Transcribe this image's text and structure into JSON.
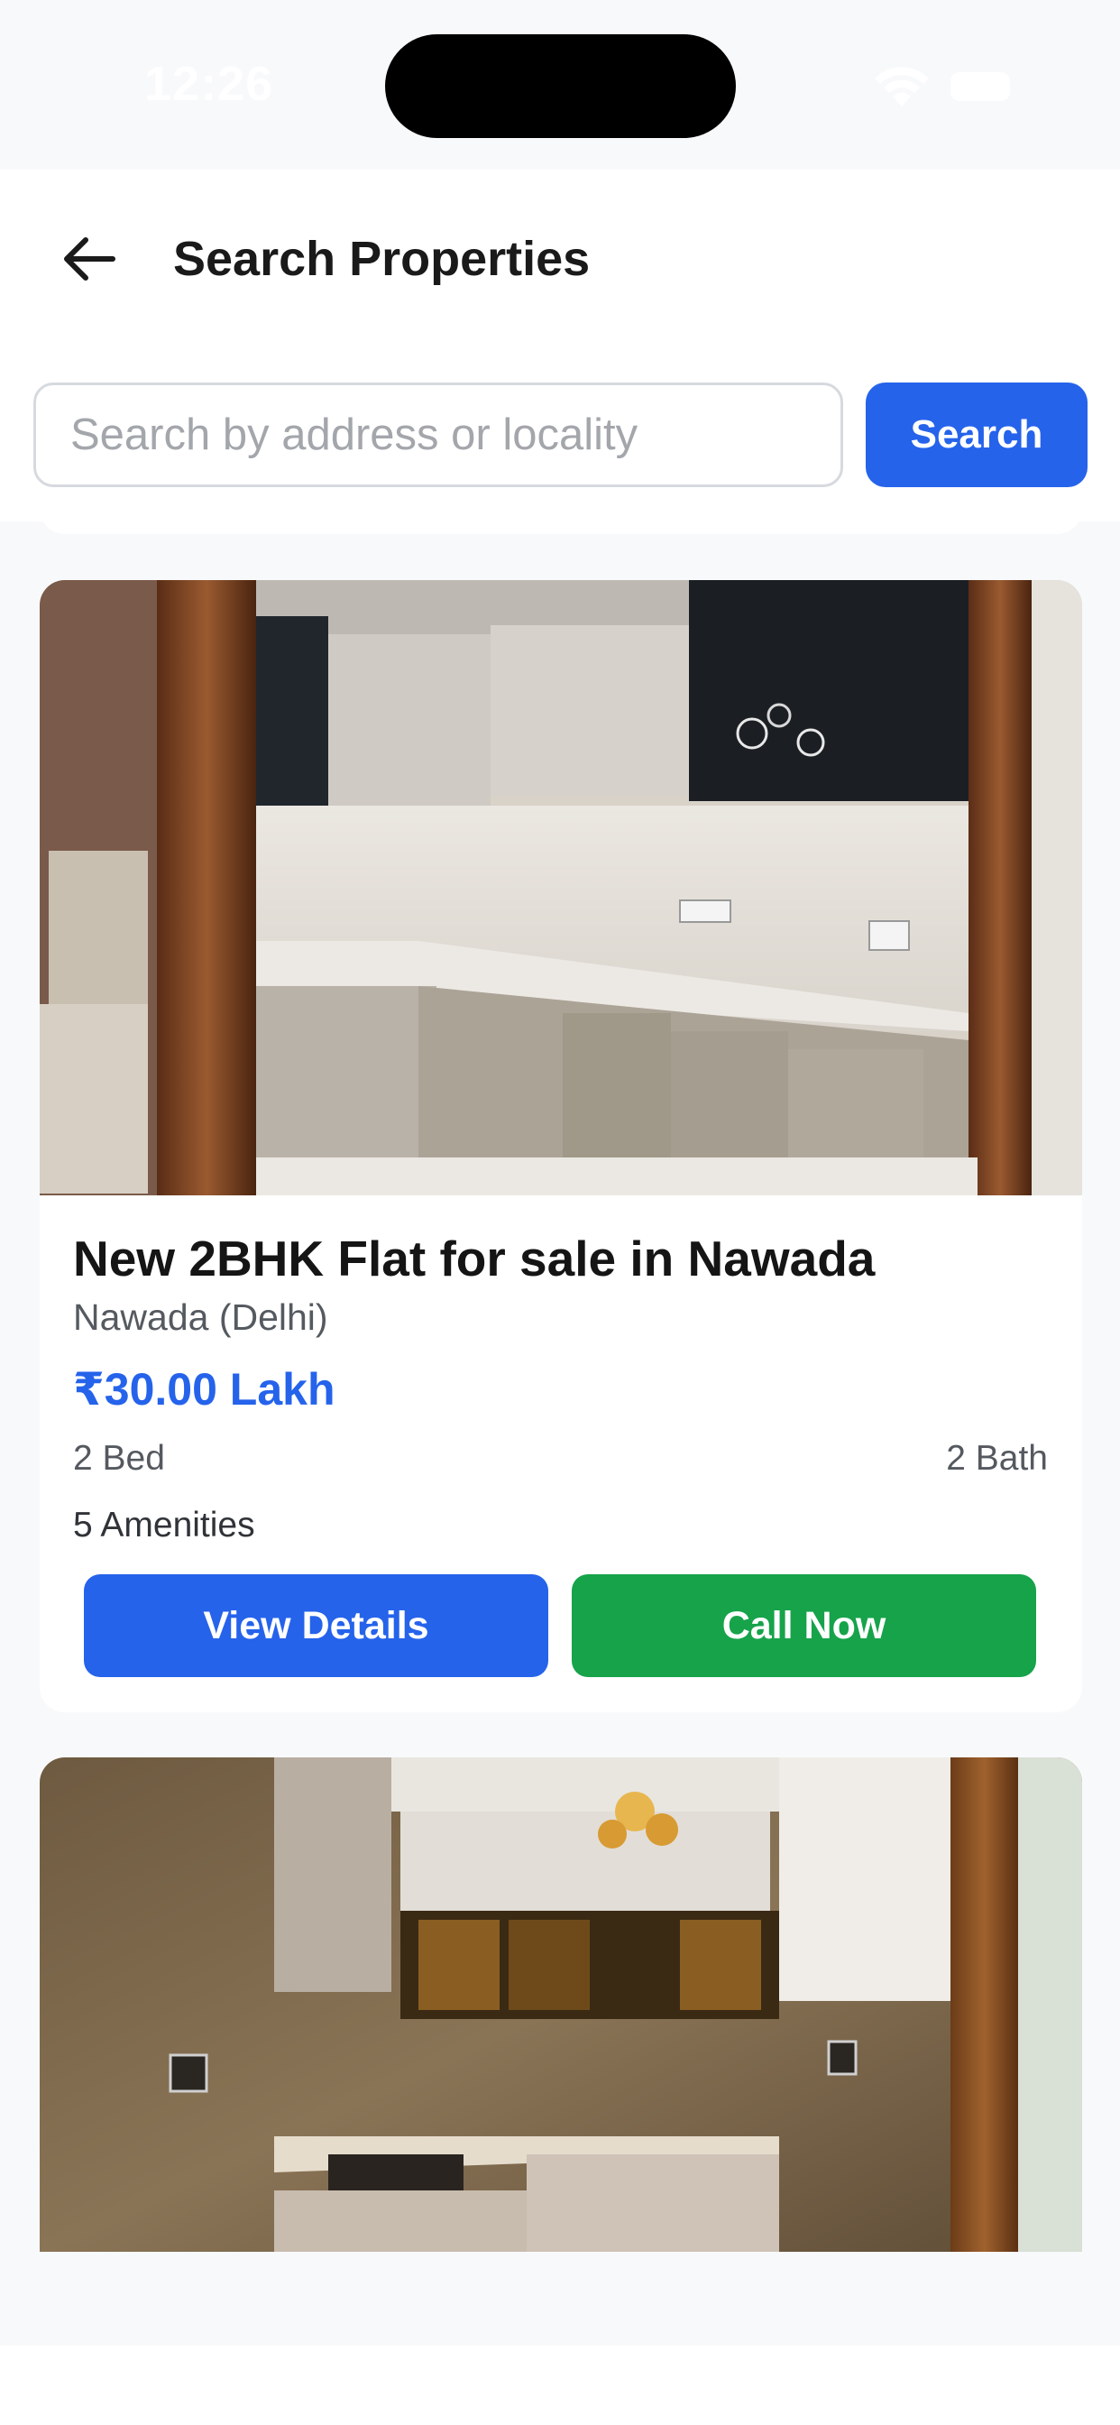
{
  "status_bar": {
    "time": "12:26",
    "icons": [
      "wifi-icon",
      "battery-icon"
    ]
  },
  "header": {
    "back_icon": "arrow-left-icon",
    "title": "Search Properties"
  },
  "search": {
    "placeholder": "Search by address or locality",
    "value": "",
    "button_label": "Search"
  },
  "listings": [
    {
      "title": "New 2BHK Flat for sale in Nawada",
      "location": "Nawada (Delhi)",
      "price": "₹30.00 Lakh",
      "beds": "2 Bed",
      "baths": "2 Bath",
      "amenities": "5 Amenities",
      "view_details_label": "View Details",
      "call_now_label": "Call Now"
    }
  ],
  "colors": {
    "primary": "#2563eb",
    "call_green": "#16a34a",
    "background": "#f8f9fb"
  }
}
